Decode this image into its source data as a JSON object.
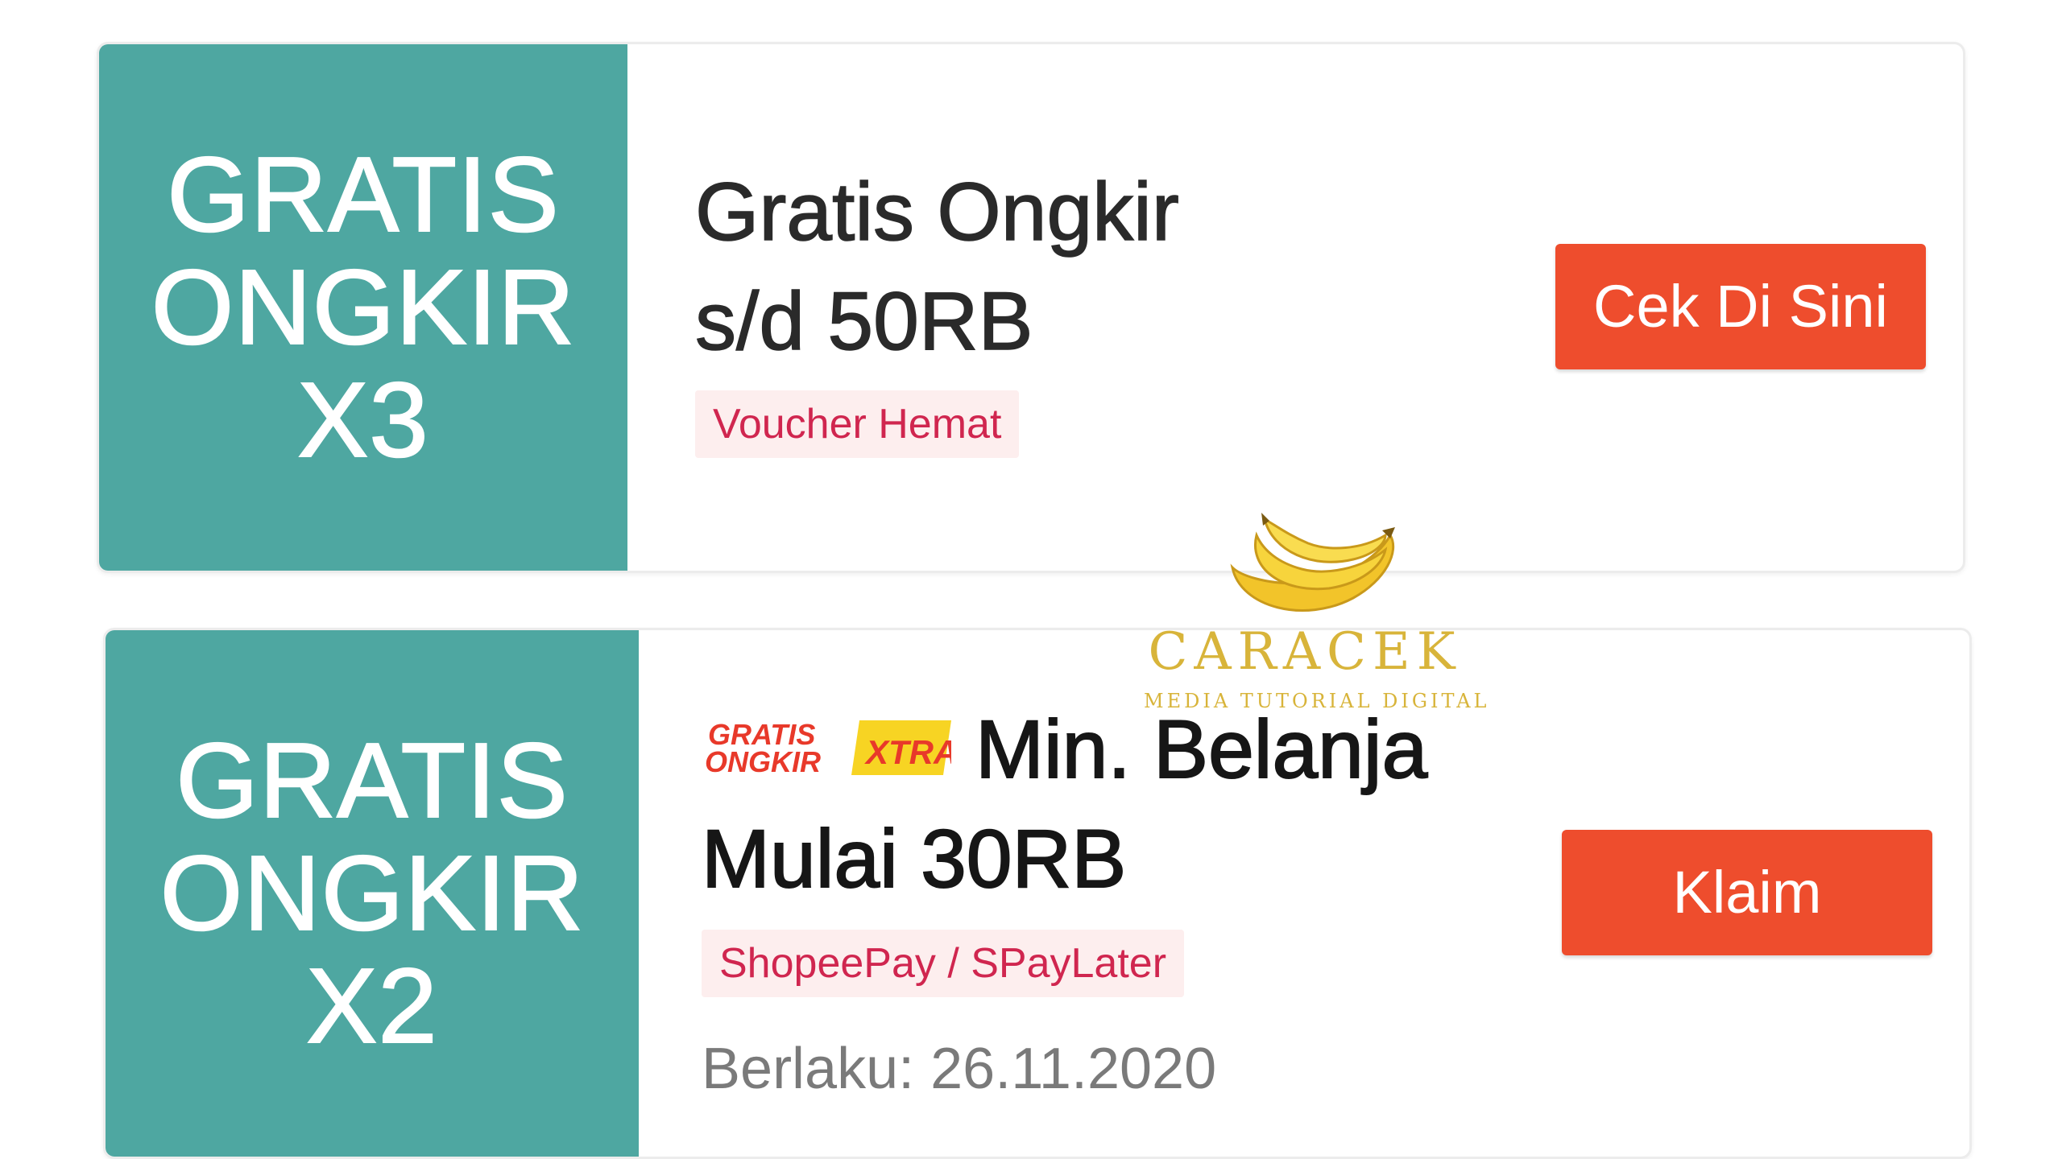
{
  "vouchers": [
    {
      "stub": {
        "line1": "GRATIS",
        "line2": "ONGKIR",
        "line3": "X3"
      },
      "title_line1": "Gratis Ongkir",
      "title_line2": "s/d 50RB",
      "tag": "Voucher Hemat",
      "button": "Cek Di Sini",
      "validity": ""
    },
    {
      "stub": {
        "line1": "GRATIS",
        "line2": "ONGKIR",
        "line3": "X2"
      },
      "badge_text": [
        "GRATIS",
        "ONGKIR",
        "XTRA"
      ],
      "title_line1": "Min. Belanja",
      "title_line2": "Mulai 30RB",
      "tag": "ShopeePay / SPayLater",
      "button": "Klaim",
      "validity": "Berlaku: 26.11.2020"
    }
  ],
  "watermark": {
    "name": "CARACEK",
    "subtitle": "MEDIA TUTORIAL DIGITAL"
  },
  "colors": {
    "stub": "#4ea7a1",
    "button": "#ee4d2d",
    "tag_bg": "#fdeeee",
    "tag_text": "#d0264f",
    "badge_red": "#e8392a",
    "badge_yellow": "#f7d423"
  }
}
